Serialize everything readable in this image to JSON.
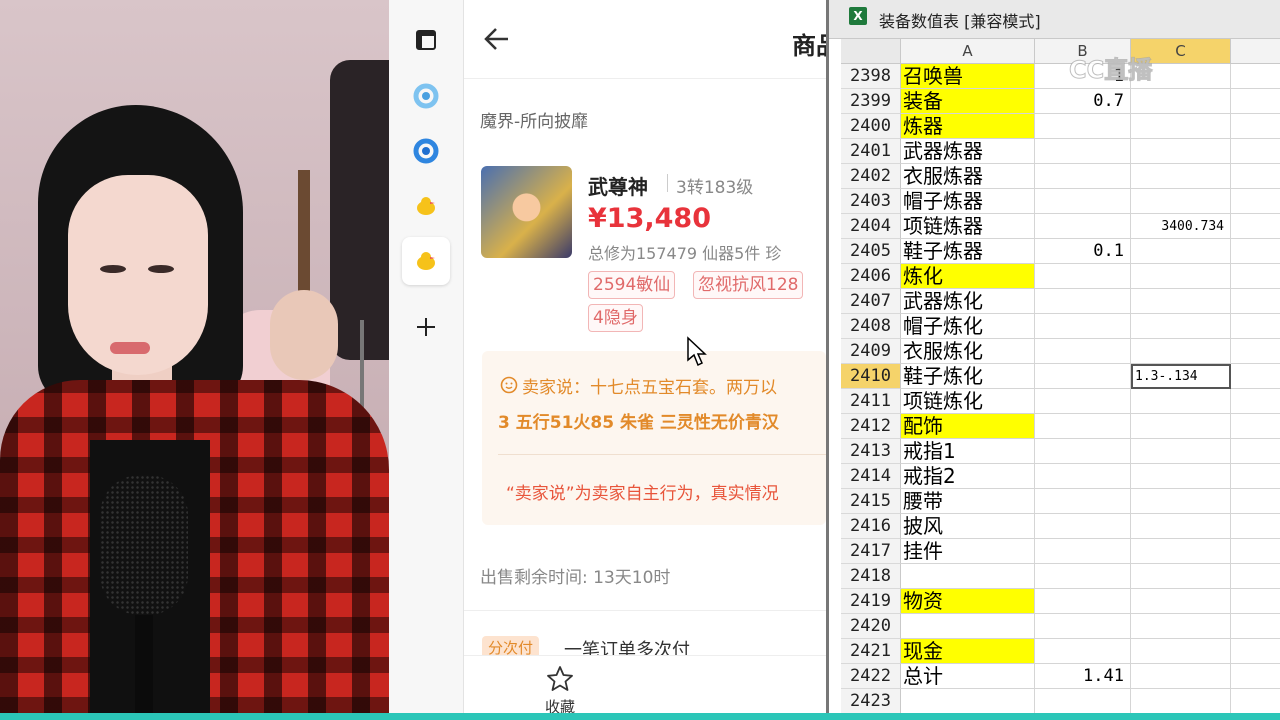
{
  "sidebar": {
    "items": [
      {
        "icon": "tab-panel-icon"
      },
      {
        "icon": "game-logo-icon"
      },
      {
        "icon": "game-logo-icon"
      },
      {
        "icon": "chick-icon"
      },
      {
        "icon": "chick-icon"
      },
      {
        "icon": "plus-icon"
      }
    ]
  },
  "app": {
    "title": "商品",
    "area": "魔界-所向披靡",
    "listing": {
      "name": "武尊神",
      "level": "3转183级",
      "price": "¥13,480",
      "meta": "总修为157479  仙器5件  珍",
      "tags": [
        "2594敏仙",
        "忽视抗风128",
        "4隐身"
      ]
    },
    "seller": {
      "line1": "卖家说：十七点五宝石套。两万以",
      "line2": "3 五行51火85 朱雀 三灵性无价青汉",
      "note": "“卖家说”为卖家自主行为，真实情况"
    },
    "remaining": "出售剩余时间: 13天10时",
    "pay": {
      "tag": "分次付",
      "text": "一笔订单多次付"
    },
    "bottom": {
      "fav_label": "收藏"
    }
  },
  "excel": {
    "window_title": "装备数值表  [兼容模式]",
    "watermark": "CC直播",
    "columns": [
      "A",
      "B",
      "C"
    ],
    "rows": [
      {
        "n": "2398",
        "a": "召唤兽",
        "hl": true,
        "b": "1",
        "c": ""
      },
      {
        "n": "2399",
        "a": "装备",
        "hl": true,
        "b": "0.7",
        "c": ""
      },
      {
        "n": "2400",
        "a": "炼器",
        "hl": true,
        "b": "",
        "c": ""
      },
      {
        "n": "2401",
        "a": "武器炼器",
        "hl": false,
        "b": "",
        "c": ""
      },
      {
        "n": "2402",
        "a": "衣服炼器",
        "hl": false,
        "b": "",
        "c": ""
      },
      {
        "n": "2403",
        "a": "帽子炼器",
        "hl": false,
        "b": "",
        "c": ""
      },
      {
        "n": "2404",
        "a": "项链炼器",
        "hl": false,
        "b": "",
        "c": "3400.734"
      },
      {
        "n": "2405",
        "a": "鞋子炼器",
        "hl": false,
        "b": "0.1",
        "c": ""
      },
      {
        "n": "2406",
        "a": "炼化",
        "hl": true,
        "b": "",
        "c": ""
      },
      {
        "n": "2407",
        "a": "武器炼化",
        "hl": false,
        "b": "",
        "c": ""
      },
      {
        "n": "2408",
        "a": "帽子炼化",
        "hl": false,
        "b": "",
        "c": ""
      },
      {
        "n": "2409",
        "a": "衣服炼化",
        "hl": false,
        "b": "",
        "c": ""
      },
      {
        "n": "2410",
        "a": "鞋子炼化",
        "hl": false,
        "b": "",
        "c": "1.3-.134"
      },
      {
        "n": "2411",
        "a": "项链炼化",
        "hl": false,
        "b": "",
        "c": ""
      },
      {
        "n": "2412",
        "a": "配饰",
        "hl": true,
        "b": "",
        "c": ""
      },
      {
        "n": "2413",
        "a": "戒指1",
        "hl": false,
        "b": "",
        "c": ""
      },
      {
        "n": "2414",
        "a": "戒指2",
        "hl": false,
        "b": "",
        "c": ""
      },
      {
        "n": "2415",
        "a": "腰带",
        "hl": false,
        "b": "",
        "c": ""
      },
      {
        "n": "2416",
        "a": "披风",
        "hl": false,
        "b": "",
        "c": ""
      },
      {
        "n": "2417",
        "a": "挂件",
        "hl": false,
        "b": "",
        "c": ""
      },
      {
        "n": "2418",
        "a": "",
        "hl": false,
        "b": "",
        "c": ""
      },
      {
        "n": "2419",
        "a": "物资",
        "hl": true,
        "b": "",
        "c": ""
      },
      {
        "n": "2420",
        "a": "",
        "hl": false,
        "b": "",
        "c": ""
      },
      {
        "n": "2421",
        "a": "现金",
        "hl": true,
        "b": "",
        "c": ""
      },
      {
        "n": "2422",
        "a": "总计",
        "hl": false,
        "b": "1.41",
        "c": ""
      },
      {
        "n": "2423",
        "a": "",
        "hl": false,
        "b": "",
        "c": ""
      }
    ],
    "selected_row": "2410",
    "highlight_color": "#ffff00"
  }
}
